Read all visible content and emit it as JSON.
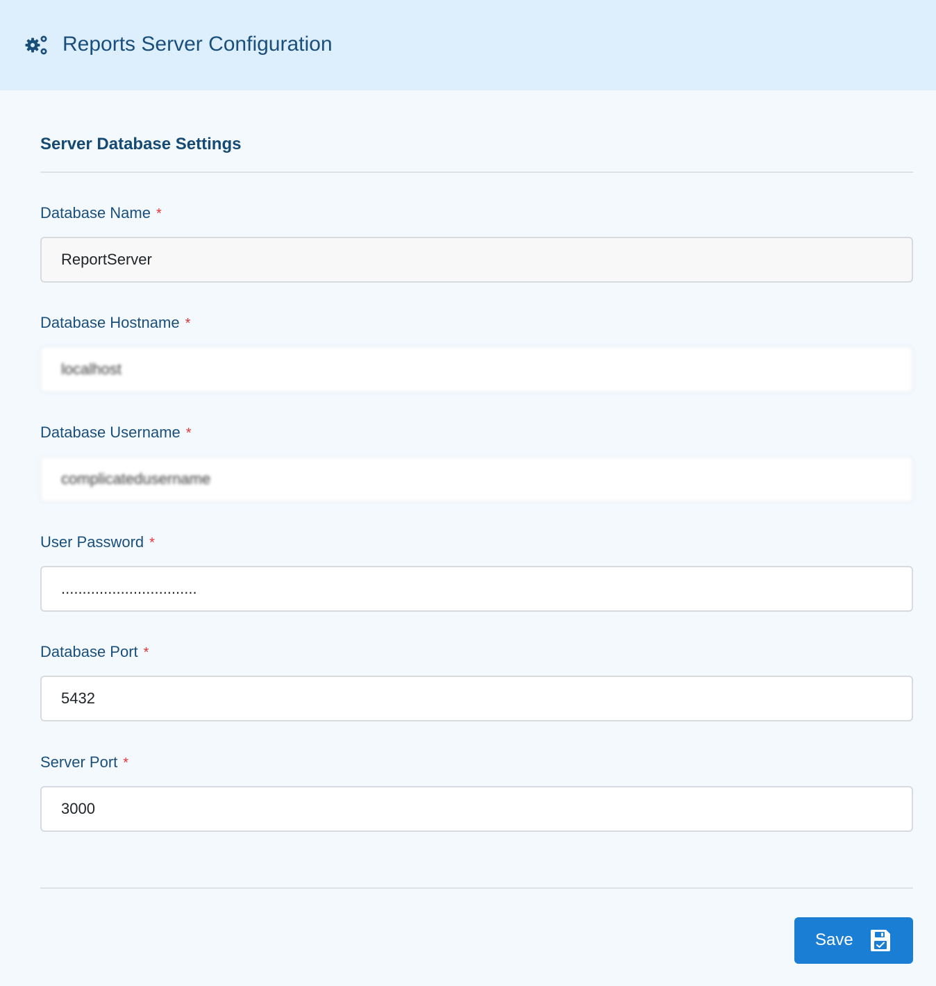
{
  "header": {
    "icon": "gears-icon",
    "title": "Reports Server Configuration"
  },
  "section": {
    "title": "Server Database Settings"
  },
  "fields": [
    {
      "label": "Database Name",
      "required": "*",
      "value": "ReportServer"
    },
    {
      "label": "Database Hostname",
      "required": "*",
      "value": "localhost"
    },
    {
      "label": "Database Username",
      "required": "*",
      "value": "complicatedusername"
    },
    {
      "label": "User Password",
      "required": "*",
      "value": "................................"
    },
    {
      "label": "Database Port",
      "required": "*",
      "value": "5432"
    },
    {
      "label": "Server Port",
      "required": "*",
      "value": "3000"
    }
  ],
  "footer": {
    "save_label": "Save",
    "save_icon": "floppy-disk-icon"
  },
  "colors": {
    "header_bg": "#ddeefd",
    "page_bg": "#f4f9fe",
    "title_text": "#1a4f7c",
    "required_marker": "#e0373a",
    "primary_button": "#1a7ed4"
  }
}
